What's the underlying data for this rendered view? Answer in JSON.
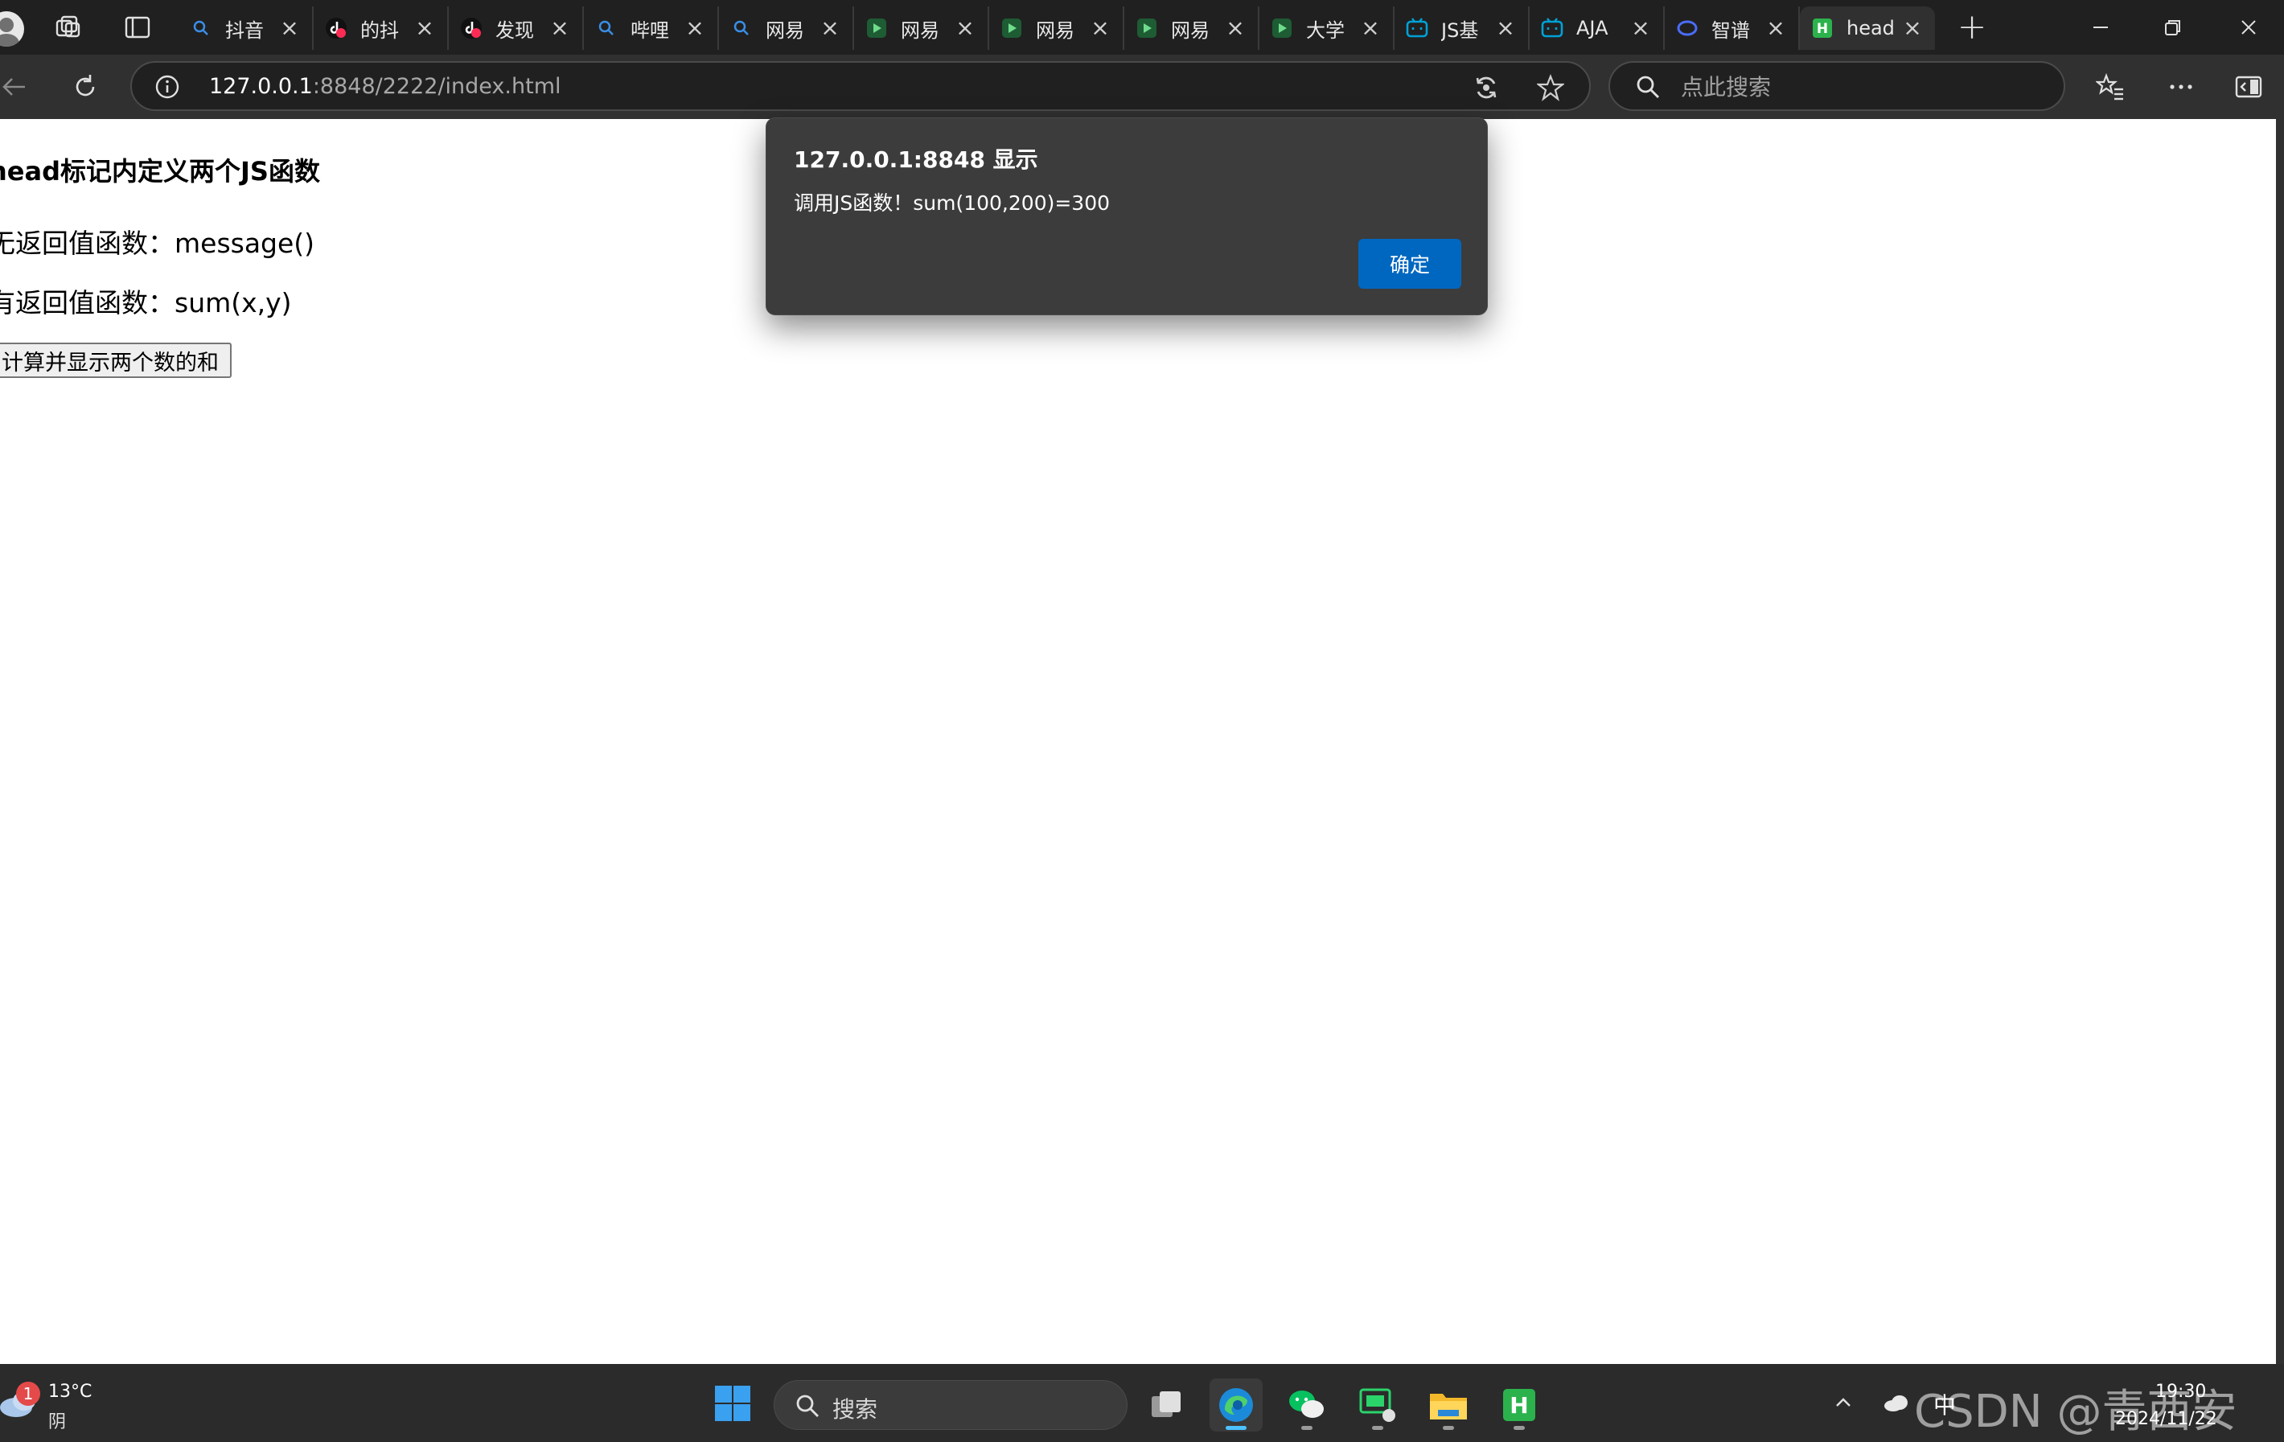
{
  "browser": {
    "tabs": [
      {
        "label": "抖音",
        "favicon": "search-icon"
      },
      {
        "label": "的抖",
        "favicon": "douyin-icon"
      },
      {
        "label": "发现",
        "favicon": "douyin-icon"
      },
      {
        "label": "哔哩",
        "favicon": "search-icon"
      },
      {
        "label": "网易",
        "favicon": "search-icon"
      },
      {
        "label": "网易",
        "favicon": "play-icon"
      },
      {
        "label": "网易",
        "favicon": "play-icon"
      },
      {
        "label": "网易",
        "favicon": "play-icon"
      },
      {
        "label": "大学",
        "favicon": "play-icon"
      },
      {
        "label": "JS基",
        "favicon": "bilibili-icon"
      },
      {
        "label": "AJA",
        "favicon": "bilibili-icon"
      },
      {
        "label": "智谱",
        "favicon": "zhipu-icon"
      },
      {
        "label": "head",
        "favicon": "hbuilder-icon",
        "active": true
      }
    ],
    "address": {
      "host": "127.0.0.1",
      "rest": ":8848/2222/index.html"
    },
    "search_placeholder": "点此搜索"
  },
  "page": {
    "heading": "head标记内定义两个JS函数",
    "line1": "无返回值函数：message()",
    "line2": "有返回值函数：sum(x,y)",
    "button_label": "计算并显示两个数的和"
  },
  "dialog": {
    "title": "127.0.0.1:8848 显示",
    "message": "调用JS函数！sum(100,200)=300",
    "ok_label": "确定"
  },
  "taskbar": {
    "weather_badge": "1",
    "temperature": "13°C",
    "condition": "阴",
    "search_label": "搜索",
    "ime": "中",
    "time": "19:30",
    "date": "2024/11/22",
    "watermark": "CSDN @青西安"
  },
  "colors": {
    "accent": "#0067c0",
    "edge_blue": "#4cc2ff",
    "hbuilder_green": "#2bb24c",
    "wechat_green": "#07c160",
    "bilibili_blue": "#00a1d6"
  }
}
